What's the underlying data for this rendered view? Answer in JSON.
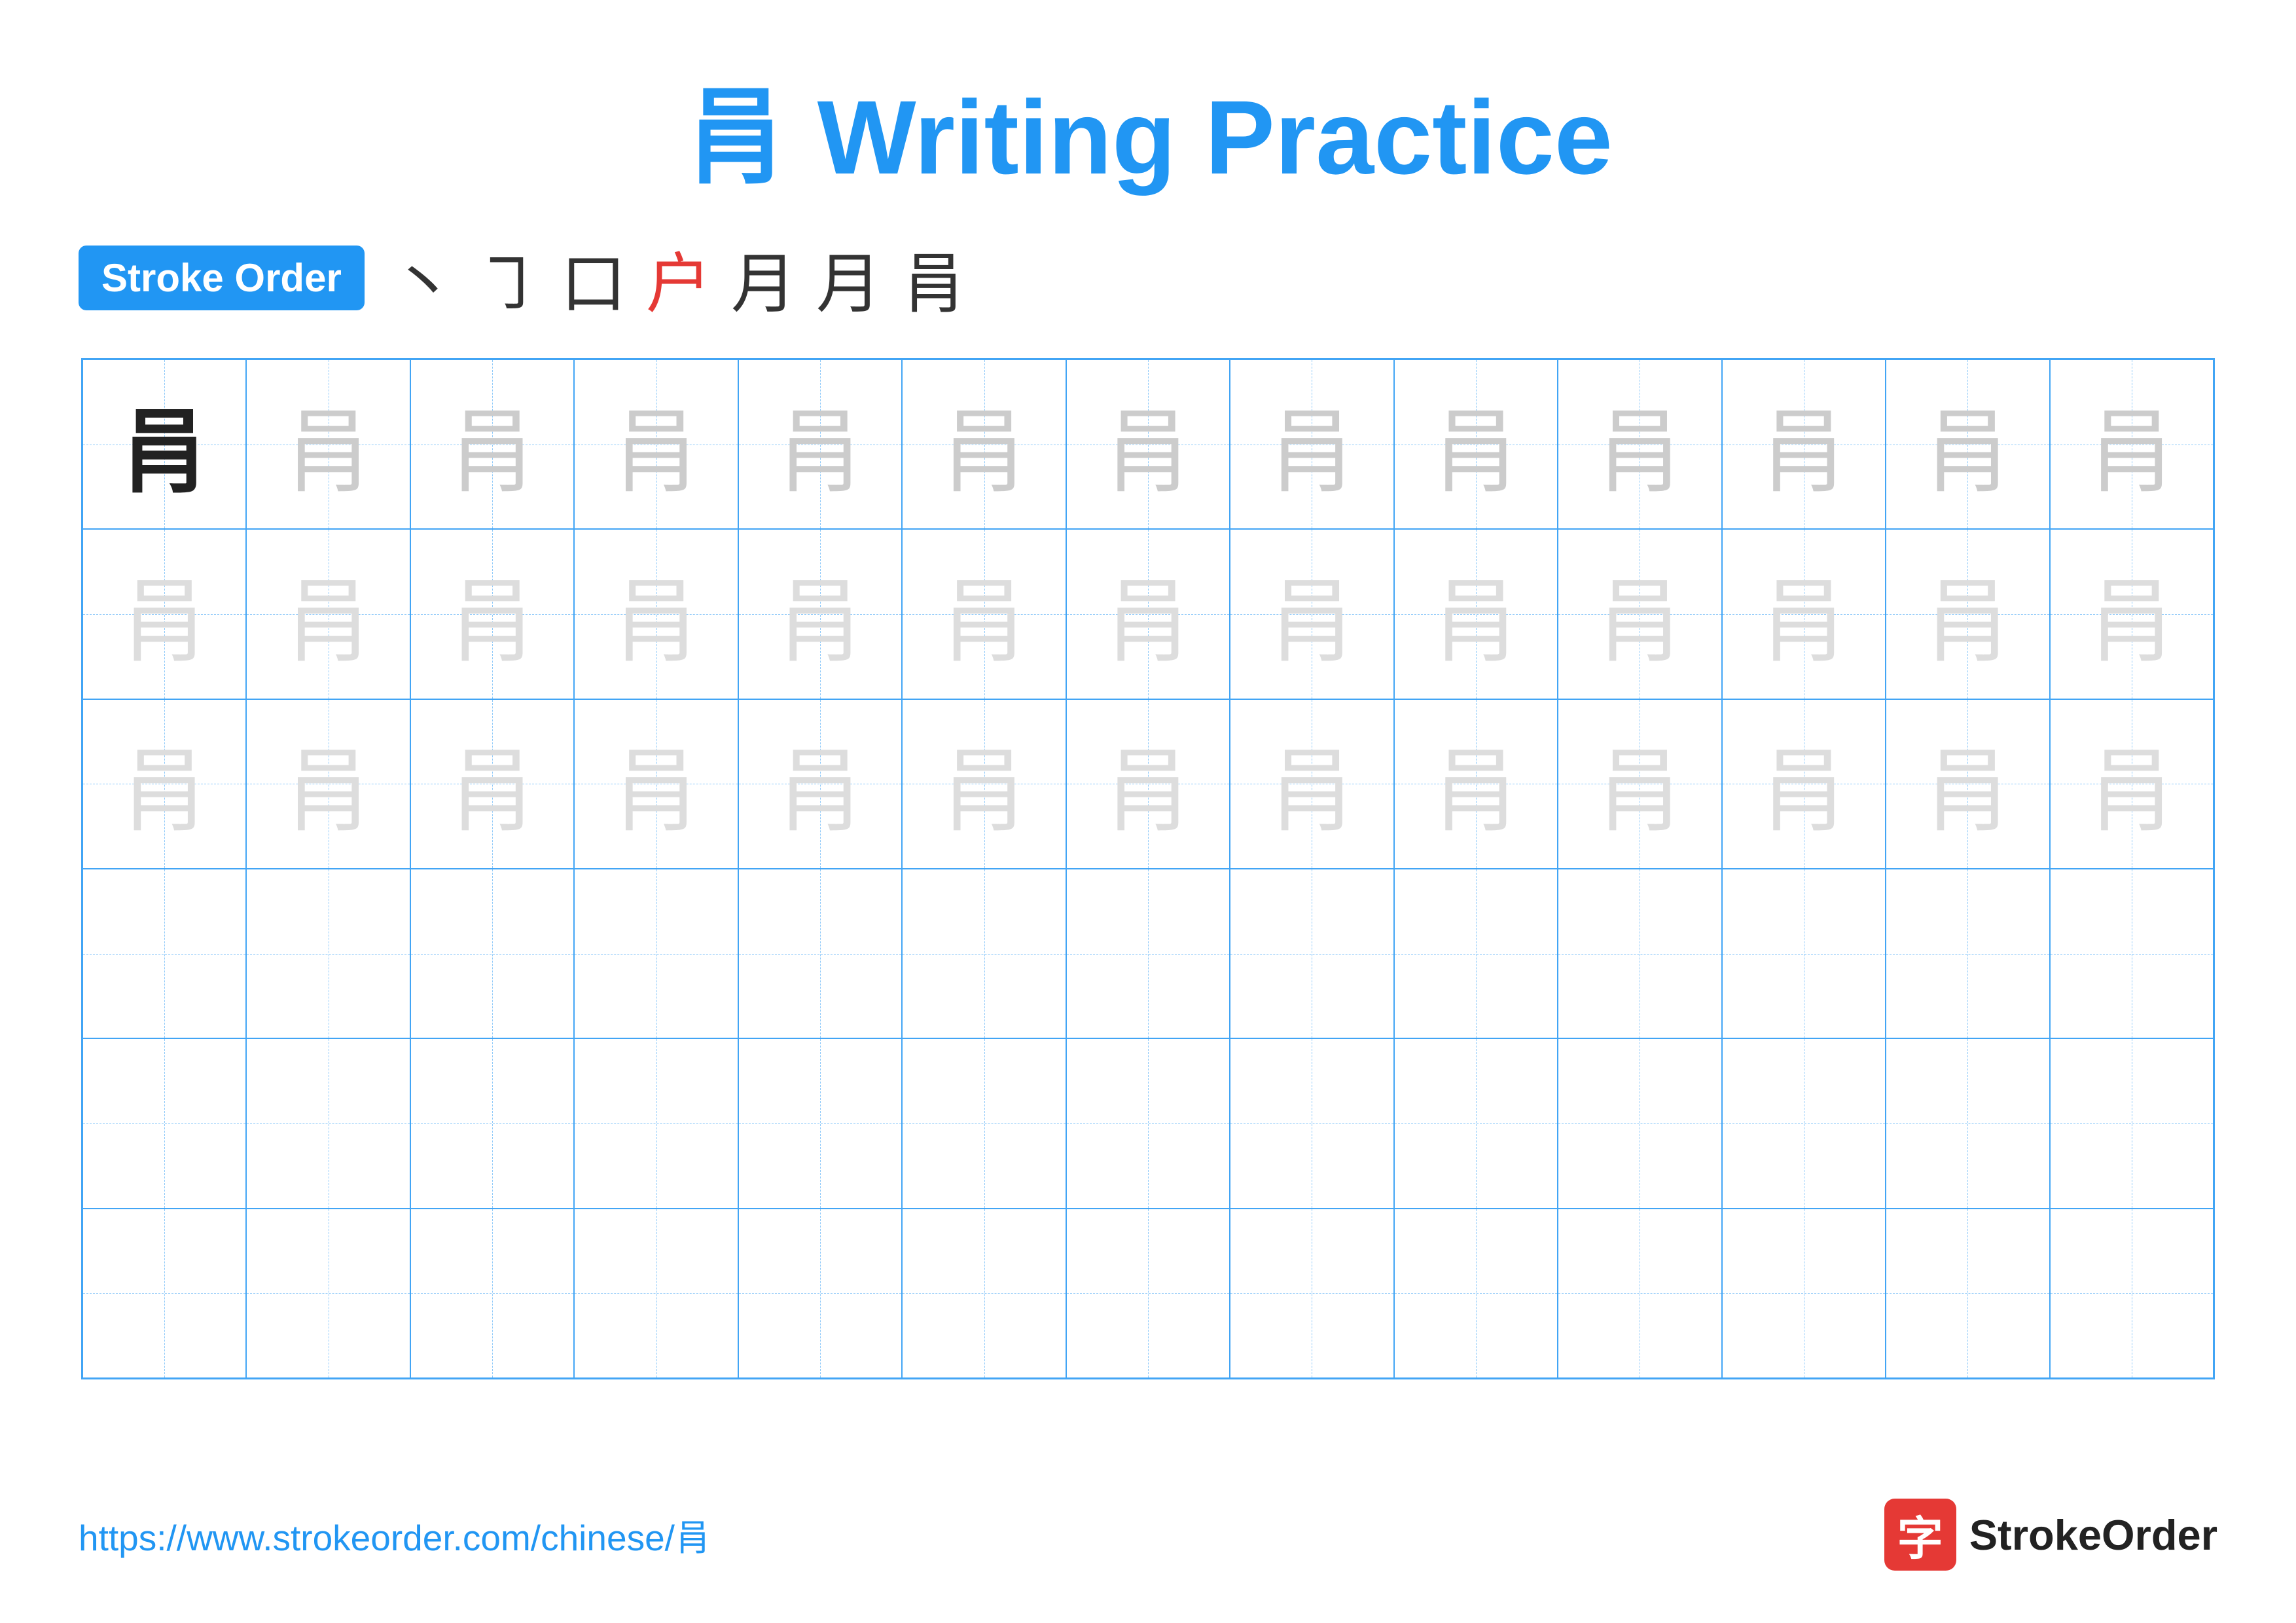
{
  "title": {
    "character": "肙",
    "text": "Writing Practice",
    "full": "肙 Writing Practice"
  },
  "stroke_order": {
    "badge_label": "Stroke Order",
    "strokes": [
      "丶",
      "㇆",
      "口",
      "户",
      "月",
      "月",
      "肙"
    ]
  },
  "grid": {
    "rows": 6,
    "cols": 13,
    "character": "肙",
    "filled_rows": 3
  },
  "footer": {
    "url": "https://www.strokeorder.com/chinese/肙",
    "logo_text": "StrokeOrder",
    "logo_char": "字"
  }
}
